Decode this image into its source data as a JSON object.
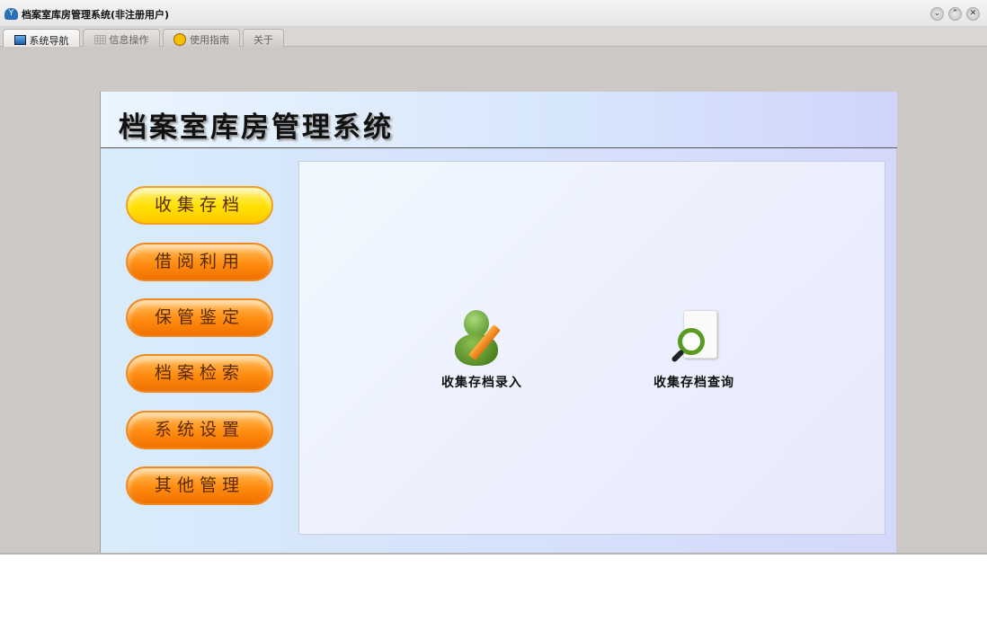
{
  "window": {
    "title": "档案室库房管理系统(非注册用户)",
    "controls": [
      "minimize",
      "maximize",
      "close"
    ]
  },
  "tabs": [
    {
      "label": "系统导航",
      "icon": "monitor-icon"
    },
    {
      "label": "信息操作",
      "icon": "grid-icon"
    },
    {
      "label": "使用指南",
      "icon": "help-icon"
    },
    {
      "label": "关于"
    }
  ],
  "header": {
    "title": "档案室库房管理系统"
  },
  "nav": [
    "收集存档",
    "借阅利用",
    "保管鉴定",
    "档案检索",
    "系统设置",
    "其他管理"
  ],
  "functions": [
    {
      "label": "收集存档录入",
      "icon": "user-edit-icon"
    },
    {
      "label": "收集存档查询",
      "icon": "document-search-icon"
    }
  ]
}
